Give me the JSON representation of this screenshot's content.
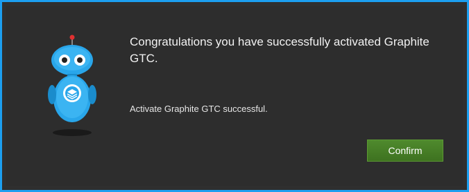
{
  "dialog": {
    "title": "Congratulations you have successfully activated Graphite GTC.",
    "detail": "Activate Graphite GTC successful.",
    "confirm_label": "Confirm"
  },
  "mascot": {
    "icon": "robot-mascot-icon"
  },
  "colors": {
    "frame_border": "#1c9ff0",
    "background": "#2d2d2d",
    "confirm_button": "#4a8427",
    "robot_body": "#29a6ea"
  }
}
